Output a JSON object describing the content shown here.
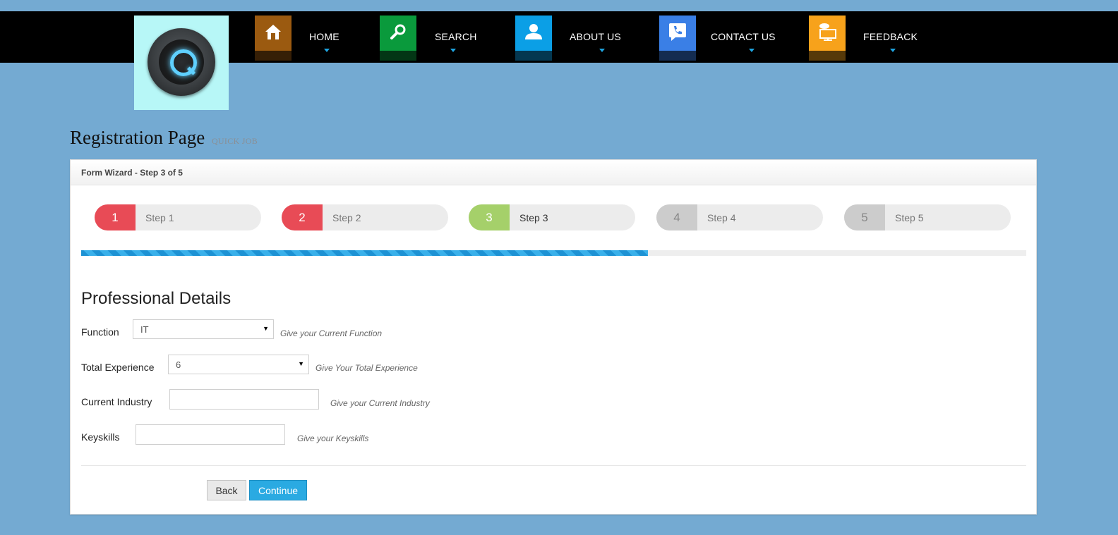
{
  "nav": {
    "items": [
      {
        "label": "HOME",
        "icon": "home-icon",
        "color": "#9b5a10"
      },
      {
        "label": "SEARCH",
        "icon": "search-icon",
        "color": "#0a9a3c"
      },
      {
        "label": "ABOUT US",
        "icon": "user-icon",
        "color": "#0b9fe6"
      },
      {
        "label": "CONTACT US",
        "icon": "phone-icon",
        "color": "#3a7fe6"
      },
      {
        "label": "FEEDBACK",
        "icon": "feedback-icon",
        "color": "#f7a21b"
      }
    ]
  },
  "header": {
    "title": "Registration Page",
    "subtitle": "QUICK JOB"
  },
  "wizard": {
    "panel_title": "Form Wizard - Step 3 of 5",
    "steps": [
      {
        "num": "1",
        "label": "Step 1",
        "color": "#e84b56"
      },
      {
        "num": "2",
        "label": "Step 2",
        "color": "#e84b56"
      },
      {
        "num": "3",
        "label": "Step 3",
        "color": "#a5d06a"
      },
      {
        "num": "4",
        "label": "Step 4",
        "color": "#cccccc"
      },
      {
        "num": "5",
        "label": "Step 5",
        "color": "#cccccc"
      }
    ],
    "progress_fraction": 0.6,
    "progress_color": "#2196d8"
  },
  "form": {
    "section_title": "Professional Details",
    "function": {
      "label": "Function",
      "value": "IT",
      "hint": "Give your Current Function"
    },
    "experience": {
      "label": "Total Experience",
      "value": "6",
      "hint": "Give Your Total Experience"
    },
    "industry": {
      "label": "Current Industry",
      "value": "",
      "hint": "Give your Current Industry"
    },
    "keyskills": {
      "label": "Keyskills",
      "value": "",
      "hint": "Give your Keyskills"
    },
    "back_label": "Back",
    "continue_label": "Continue"
  }
}
